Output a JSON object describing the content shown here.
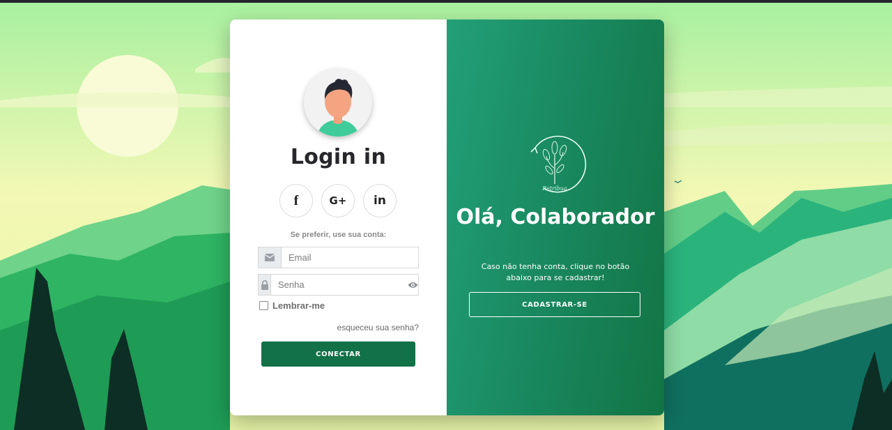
{
  "login": {
    "title": "Login in",
    "social": [
      {
        "label": "f",
        "icon": "facebook-icon"
      },
      {
        "label": "G+",
        "icon": "google-plus-icon"
      },
      {
        "label": "in",
        "icon": "linkedin-icon"
      }
    ],
    "hint": "Se preferir, use sua conta:",
    "email_placeholder": "Email",
    "password_placeholder": "Senha",
    "remember_label": "Lembrar-me",
    "forgot_label": "esqueceu sua senha?",
    "connect_label": "CONECTAR"
  },
  "welcome": {
    "logo_text": "Retribua",
    "greeting": "Olá, Colaborador",
    "message": "Caso não tenha conta, clique no botão abaixo para se cadastrar!",
    "register_label": "CADASTRAR-SE"
  },
  "colors": {
    "primary": "#127147",
    "panel_gradient_start": "#22a078",
    "panel_gradient_end": "#127444"
  }
}
